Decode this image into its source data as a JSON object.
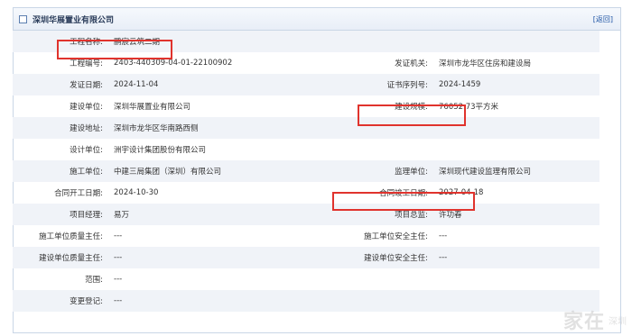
{
  "header": {
    "title": "深圳华展置业有限公司",
    "back_label": "[返回]"
  },
  "rows": [
    {
      "l1": "工程名称:",
      "v1": "鹏宸云筑二期",
      "l2": "",
      "v2": ""
    },
    {
      "l1": "工程编号:",
      "v1": "2403-440309-04-01-22100902",
      "l2": "发证机关:",
      "v2": "深圳市龙华区住房和建设局"
    },
    {
      "l1": "发证日期:",
      "v1": "2024-11-04",
      "l2": "证书序列号:",
      "v2": "2024-1459"
    },
    {
      "l1": "建设单位:",
      "v1": "深圳华展置业有限公司",
      "l2": "建设规模:",
      "v2": "76052.73平方米"
    },
    {
      "l1": "建设地址:",
      "v1": "深圳市龙华区华南路西侧",
      "l2": "",
      "v2": ""
    },
    {
      "l1": "设计单位:",
      "v1": "洲宇设计集团股份有限公司",
      "l2": "",
      "v2": ""
    },
    {
      "l1": "施工单位:",
      "v1": "中建三局集团（深圳）有限公司",
      "l2": "监理单位:",
      "v2": "深圳现代建设监理有限公司"
    },
    {
      "l1": "合同开工日期:",
      "v1": "2024-10-30",
      "l2": "合同竣工日期:",
      "v2": "2027-04-18"
    },
    {
      "l1": "项目经理:",
      "v1": "易万",
      "l2": "项目总监:",
      "v2": "许功春"
    },
    {
      "l1": "施工单位质量主任:",
      "v1": "---",
      "l2": "施工单位安全主任:",
      "v2": "---"
    },
    {
      "l1": "建设单位质量主任:",
      "v1": "---",
      "l2": "建设单位安全主任:",
      "v2": "---"
    },
    {
      "l1": "范围:",
      "v1": "---",
      "l2": "",
      "v2": ""
    },
    {
      "l1": "变更登记:",
      "v1": "---",
      "l2": "",
      "v2": ""
    }
  ],
  "watermark": {
    "big": "家在",
    "small": "深圳"
  }
}
